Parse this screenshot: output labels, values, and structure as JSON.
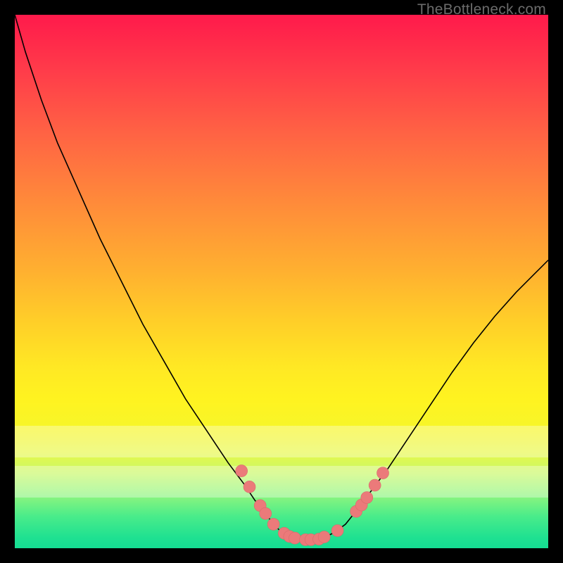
{
  "attribution": "TheBottleneck.com",
  "colors": {
    "curve_stroke": "#000000",
    "marker_fill": "#eb7a7a",
    "marker_stroke": "#d86a6a",
    "frame_border": "#000000"
  },
  "chart_data": {
    "type": "line",
    "title": "",
    "xlabel": "",
    "ylabel": "",
    "xlim": [
      0,
      100
    ],
    "ylim": [
      0,
      100
    ],
    "grid": false,
    "series": [
      {
        "name": "curve",
        "x": [
          0,
          2,
          5,
          8,
          12,
          16,
          20,
          24,
          28,
          32,
          36,
          40,
          43,
          45,
          47,
          48.5,
          50,
          52,
          54,
          56,
          58,
          60,
          62,
          64,
          67,
          70,
          74,
          78,
          82,
          86,
          90,
          94,
          98,
          100
        ],
        "y": [
          100,
          93,
          84,
          76,
          67,
          58,
          50,
          42,
          35,
          28,
          22,
          16,
          12,
          9,
          6.5,
          4.5,
          3,
          2,
          1.5,
          1.5,
          2,
          3,
          4.5,
          7,
          11,
          15,
          21,
          27,
          33,
          38.5,
          43.5,
          48,
          52,
          54
        ]
      }
    ],
    "markers": {
      "name": "dots",
      "points": [
        {
          "x": 42.5,
          "y": 14.5
        },
        {
          "x": 44,
          "y": 11.5
        },
        {
          "x": 46,
          "y": 8
        },
        {
          "x": 47,
          "y": 6.5
        },
        {
          "x": 48.5,
          "y": 4.5
        },
        {
          "x": 50.5,
          "y": 2.8
        },
        {
          "x": 51.5,
          "y": 2.2
        },
        {
          "x": 52.5,
          "y": 1.9
        },
        {
          "x": 54.5,
          "y": 1.6
        },
        {
          "x": 55.5,
          "y": 1.6
        },
        {
          "x": 57,
          "y": 1.7
        },
        {
          "x": 58,
          "y": 2.1
        },
        {
          "x": 60.5,
          "y": 3.3
        },
        {
          "x": 64,
          "y": 6.9
        },
        {
          "x": 65,
          "y": 8.1
        },
        {
          "x": 66,
          "y": 9.5
        },
        {
          "x": 67.5,
          "y": 11.8
        },
        {
          "x": 69,
          "y": 14.1
        }
      ],
      "radius": 8.5
    },
    "haze_bands": [
      {
        "y_top": 23,
        "y_bottom": 17,
        "opacity": 0.33
      },
      {
        "y_top": 15.5,
        "y_bottom": 9.5,
        "opacity": 0.33
      }
    ]
  }
}
